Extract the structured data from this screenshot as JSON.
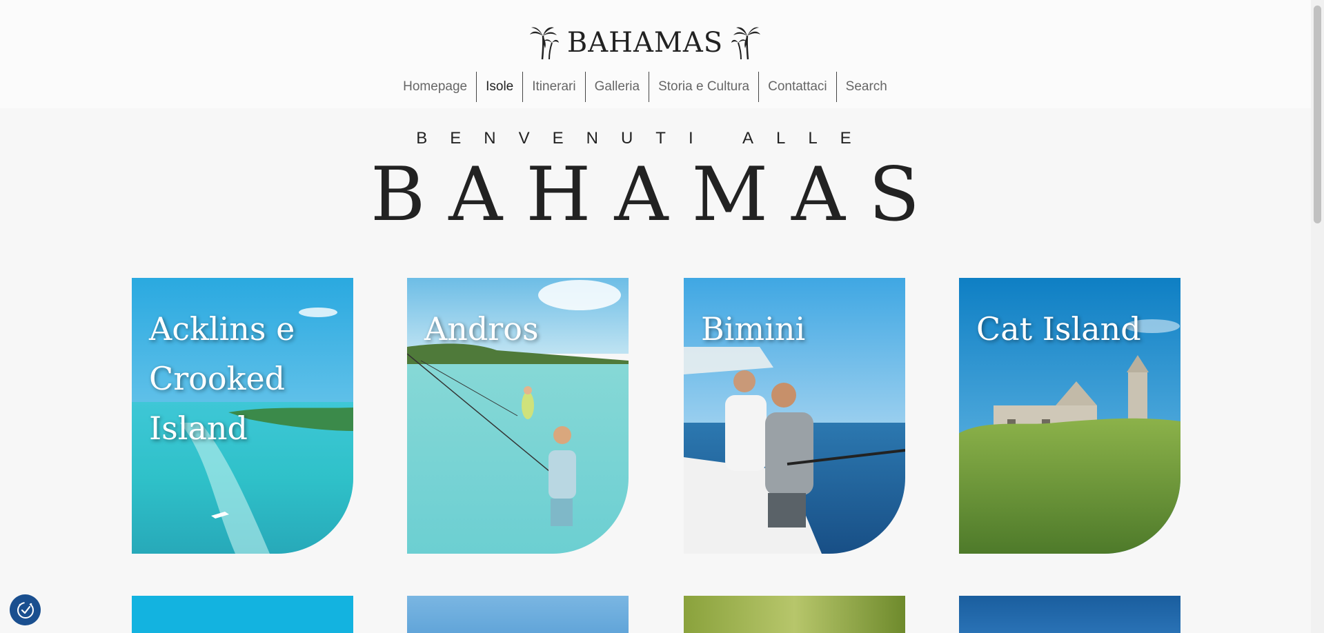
{
  "site": {
    "logo_text": "BAHAMAS"
  },
  "nav": {
    "items": [
      {
        "label": "Homepage"
      },
      {
        "label": "Isole"
      },
      {
        "label": "Itinerari"
      },
      {
        "label": "Galleria"
      },
      {
        "label": "Storia e Cultura"
      },
      {
        "label": "Contattaci"
      },
      {
        "label": "Search"
      }
    ],
    "active": "Isole"
  },
  "hero": {
    "subtitle": "BENVENUTI ALLE",
    "title": "BAHAMAS"
  },
  "islands": [
    {
      "name": "Acklins e Crooked Island"
    },
    {
      "name": "Andros"
    },
    {
      "name": "Bimini"
    },
    {
      "name": "Cat Island"
    }
  ],
  "icons": {
    "logo_left": "palm-tree-icon",
    "logo_right": "palm-tree-icon",
    "cookie": "cookie-consent-icon"
  },
  "colors": {
    "text": "#222222",
    "nav_text": "#666666",
    "background": "#f7f7f7",
    "header_bg": "#fbfbfb",
    "cookie_button": "#1a4f8f"
  }
}
